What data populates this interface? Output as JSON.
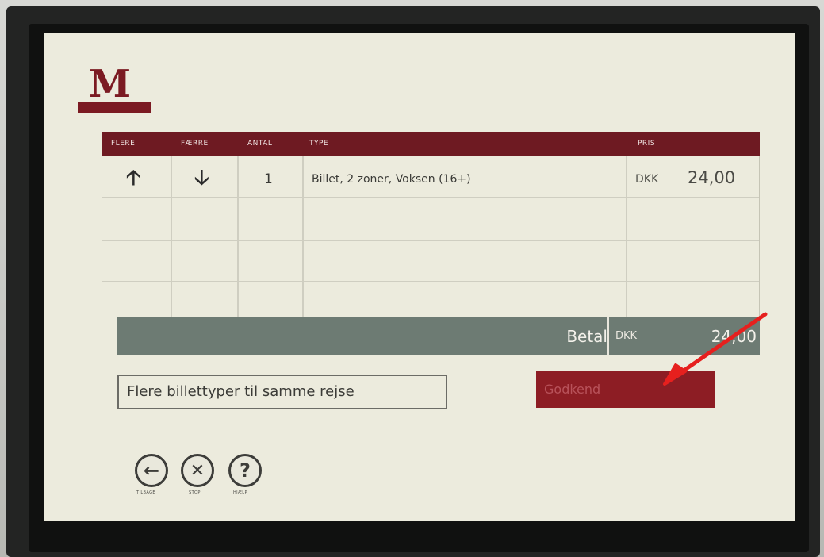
{
  "header": {
    "logo_letter": "M"
  },
  "table": {
    "columns": [
      "Flere",
      "Færre",
      "Antal",
      "Type",
      "Pris"
    ],
    "rows": [
      {
        "antal": "1",
        "type": "Billet, 2 zoner, Voksen (16+)",
        "currency": "DKK",
        "price": "24,00"
      }
    ]
  },
  "total": {
    "label": "Betal",
    "currency": "DKK",
    "amount": "24,00"
  },
  "info_text": "Flere billettyper til samme rejse",
  "approve_label": "Godkend",
  "nav": {
    "back_label": "Tilbage",
    "stop_label": "Stop",
    "help_label": "Hjælp"
  },
  "colors": {
    "accent": "#7b1a22",
    "total_bar": "#6d7b73",
    "screen_bg": "#ecebdd",
    "annotation_arrow": "#e6201e"
  }
}
